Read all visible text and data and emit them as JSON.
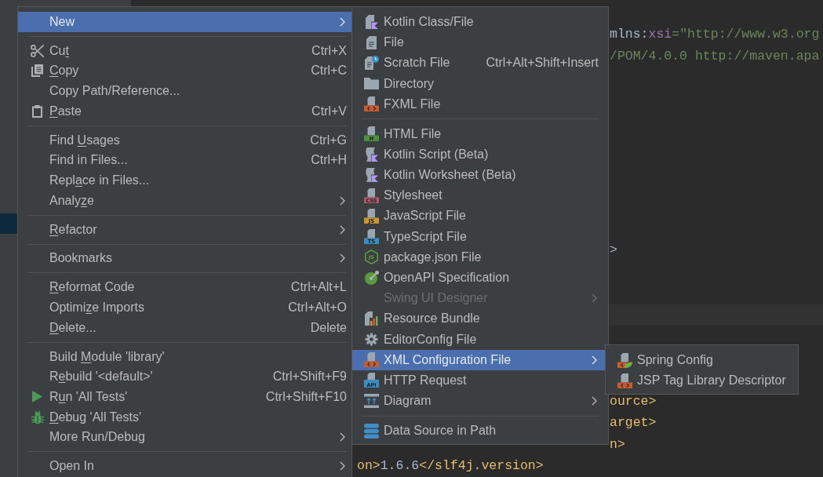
{
  "editor": {
    "lines": [
      {
        "kind": "after_submenu",
        "current": false,
        "segments": [
          {
            "kind": "plain",
            "text": "mlns:"
          },
          {
            "kind": "namespace",
            "text": "xsi"
          },
          {
            "kind": "value",
            "text": "=\"http://www.w3.org"
          }
        ]
      },
      {
        "kind": "after_submenu",
        "current": false,
        "segments": [
          {
            "kind": "value",
            "text": "/POM/4.0.0 http://maven.apa"
          }
        ]
      },
      {
        "kind": "blank"
      },
      {
        "kind": "blank"
      },
      {
        "kind": "blank"
      },
      {
        "kind": "blank"
      },
      {
        "kind": "blank"
      },
      {
        "kind": "blank"
      },
      {
        "kind": "blank"
      },
      {
        "kind": "blank"
      },
      {
        "kind": "after_submenu",
        "current": false,
        "segments": [
          {
            "kind": "plain",
            "text": ">"
          }
        ]
      },
      {
        "kind": "blank"
      },
      {
        "kind": "blank"
      },
      {
        "kind": "after_submenu",
        "current": true
      },
      {
        "kind": "blank"
      },
      {
        "kind": "blank"
      },
      {
        "kind": "blank"
      },
      {
        "kind": "after_submenu",
        "current": false,
        "segments": [
          {
            "kind": "tag",
            "text": "ource>"
          }
        ]
      },
      {
        "kind": "after_submenu",
        "current": false,
        "segments": [
          {
            "kind": "tag",
            "text": "arget>"
          }
        ]
      },
      {
        "kind": "after_submenu",
        "current": false,
        "segments": [
          {
            "kind": "tag",
            "text": "n>"
          }
        ]
      },
      {
        "kind": "after_menu",
        "current": false,
        "segments": [
          {
            "kind": "tag",
            "text": "on>"
          },
          {
            "kind": "plain",
            "text": "1.6.6"
          },
          {
            "kind": "tag",
            "text": "</slf4j.version>"
          }
        ]
      }
    ]
  },
  "context_menu": {
    "groups": [
      {
        "items": [
          {
            "label": [
              {
                "text": "New",
                "underlined": false
              }
            ],
            "has_submenu": true,
            "selected": true
          }
        ]
      },
      {
        "items": [
          {
            "label": [
              {
                "text": "Cu",
                "underlined": false
              },
              {
                "text": "t",
                "underlined": true
              }
            ],
            "shortcut": "Ctrl+X",
            "has_submenu": false,
            "selected": false
          },
          {
            "label": [
              {
                "text": "C",
                "underlined": true
              },
              {
                "text": "opy",
                "underlined": false
              }
            ],
            "shortcut": "Ctrl+C",
            "has_submenu": false,
            "selected": false
          },
          {
            "label": [
              {
                "text": "Copy Path/Reference...",
                "underlined": false
              }
            ],
            "has_submenu": false,
            "selected": false
          },
          {
            "label": [
              {
                "text": "P",
                "underlined": true
              },
              {
                "text": "aste",
                "underlined": false
              }
            ],
            "shortcut": "Ctrl+V",
            "has_submenu": false,
            "selected": false
          }
        ]
      },
      {
        "items": [
          {
            "label": [
              {
                "text": "Find ",
                "underlined": false
              },
              {
                "text": "U",
                "underlined": true
              },
              {
                "text": "sages",
                "underlined": false
              }
            ],
            "shortcut": "Ctrl+G",
            "has_submenu": false,
            "selected": false
          },
          {
            "label": [
              {
                "text": "Find in Files...",
                "underlined": false
              }
            ],
            "shortcut": "Ctrl+H",
            "has_submenu": false,
            "selected": false
          },
          {
            "label": [
              {
                "text": "Repl",
                "underlined": false
              },
              {
                "text": "a",
                "underlined": true
              },
              {
                "text": "ce in Files...",
                "underlined": false
              }
            ],
            "has_submenu": false,
            "selected": false
          },
          {
            "label": [
              {
                "text": "Analy",
                "underlined": false
              },
              {
                "text": "z",
                "underlined": true
              },
              {
                "text": "e",
                "underlined": false
              }
            ],
            "has_submenu": true,
            "selected": false
          }
        ]
      },
      {
        "items": [
          {
            "label": [
              {
                "text": "R",
                "underlined": true
              },
              {
                "text": "efactor",
                "underlined": false
              }
            ],
            "has_submenu": true,
            "selected": false
          }
        ]
      },
      {
        "items": [
          {
            "label": [
              {
                "text": "Bookmarks",
                "underlined": false
              }
            ],
            "has_submenu": true,
            "selected": false
          }
        ]
      },
      {
        "items": [
          {
            "label": [
              {
                "text": "R",
                "underlined": true
              },
              {
                "text": "eformat Code",
                "underlined": false
              }
            ],
            "shortcut": "Ctrl+Alt+L",
            "has_submenu": false,
            "selected": false
          },
          {
            "label": [
              {
                "text": "Optimi",
                "underlined": false
              },
              {
                "text": "z",
                "underlined": true
              },
              {
                "text": "e Imports",
                "underlined": false
              }
            ],
            "shortcut": "Ctrl+Alt+O",
            "has_submenu": false,
            "selected": false
          },
          {
            "label": [
              {
                "text": "D",
                "underlined": true
              },
              {
                "text": "elete...",
                "underlined": false
              }
            ],
            "shortcut": "Delete",
            "has_submenu": false,
            "selected": false
          }
        ]
      },
      {
        "items": [
          {
            "label": [
              {
                "text": "Build ",
                "underlined": false
              },
              {
                "text": "M",
                "underlined": true
              },
              {
                "text": "odule 'library'",
                "underlined": false
              }
            ],
            "has_submenu": false,
            "selected": false
          },
          {
            "label": [
              {
                "text": "R",
                "underlined": false
              },
              {
                "text": "e",
                "underlined": true
              },
              {
                "text": "build '<default>'",
                "underlined": false
              }
            ],
            "shortcut": "Ctrl+Shift+F9",
            "has_submenu": false,
            "selected": false
          },
          {
            "label": [
              {
                "text": "R",
                "underlined": false
              },
              {
                "text": "u",
                "underlined": true
              },
              {
                "text": "n 'All Tests'",
                "underlined": false
              }
            ],
            "shortcut": "Ctrl+Shift+F10",
            "has_submenu": false,
            "selected": false
          },
          {
            "label": [
              {
                "text": "D",
                "underlined": true
              },
              {
                "text": "ebug 'All Tests'",
                "underlined": false
              }
            ],
            "has_submenu": false,
            "selected": false
          },
          {
            "label": [
              {
                "text": "More Run/Debug",
                "underlined": false
              }
            ],
            "has_submenu": true,
            "selected": false
          }
        ]
      },
      {
        "items": [
          {
            "label": [
              {
                "text": "Open In",
                "underlined": false
              }
            ],
            "has_submenu": true,
            "selected": false
          }
        ]
      }
    ]
  },
  "new_submenu": {
    "groups": [
      {
        "items": [
          {
            "label": "Kotlin Class/File",
            "has_submenu": false,
            "selected": false,
            "disabled": false
          },
          {
            "label": "File",
            "has_submenu": false,
            "selected": false,
            "disabled": false
          },
          {
            "label": "Scratch File",
            "shortcut": "Ctrl+Alt+Shift+Insert",
            "has_submenu": false,
            "selected": false,
            "disabled": false
          },
          {
            "label": "Directory",
            "has_submenu": false,
            "selected": false,
            "disabled": false
          },
          {
            "label": "FXML File",
            "has_submenu": false,
            "selected": false,
            "disabled": false
          }
        ]
      },
      {
        "items": [
          {
            "label": "HTML File",
            "icon_text": "H",
            "has_submenu": false,
            "selected": false,
            "disabled": false
          },
          {
            "label": "Kotlin Script (Beta)",
            "has_submenu": false,
            "selected": false,
            "disabled": false
          },
          {
            "label": "Kotlin Worksheet (Beta)",
            "has_submenu": false,
            "selected": false,
            "disabled": false
          },
          {
            "label": "Stylesheet",
            "icon_text": "CSS",
            "has_submenu": false,
            "selected": false,
            "disabled": false
          },
          {
            "label": "JavaScript File",
            "icon_text": "JS",
            "has_submenu": false,
            "selected": false,
            "disabled": false
          },
          {
            "label": "TypeScript File",
            "icon_text": "TS",
            "has_submenu": false,
            "selected": false,
            "disabled": false
          },
          {
            "label": "package.json File",
            "icon_text": "JS",
            "has_submenu": false,
            "selected": false,
            "disabled": false
          },
          {
            "label": "OpenAPI Specification",
            "has_submenu": false,
            "selected": false,
            "disabled": false
          },
          {
            "label": "Swing UI Designer",
            "has_submenu": true,
            "selected": false,
            "disabled": true
          },
          {
            "label": "Resource Bundle",
            "has_submenu": false,
            "selected": false,
            "disabled": false
          },
          {
            "label": "EditorConfig File",
            "has_submenu": false,
            "selected": false,
            "disabled": false
          },
          {
            "label": "XML Configuration File",
            "has_submenu": true,
            "selected": true,
            "disabled": false
          },
          {
            "label": "HTTP Request",
            "icon_text": "API",
            "has_submenu": false,
            "selected": false,
            "disabled": false
          },
          {
            "label": "Diagram",
            "has_submenu": true,
            "selected": false,
            "disabled": false
          }
        ]
      },
      {
        "items": [
          {
            "label": "Data Source in Path",
            "has_submenu": false,
            "selected": false,
            "disabled": false
          }
        ]
      }
    ]
  },
  "xml_submenu": {
    "items": [
      {
        "label": "Spring Config",
        "has_submenu": false,
        "selected": false
      },
      {
        "label": "JSP Tag Library Descriptor",
        "has_submenu": false,
        "selected": false
      }
    ]
  }
}
